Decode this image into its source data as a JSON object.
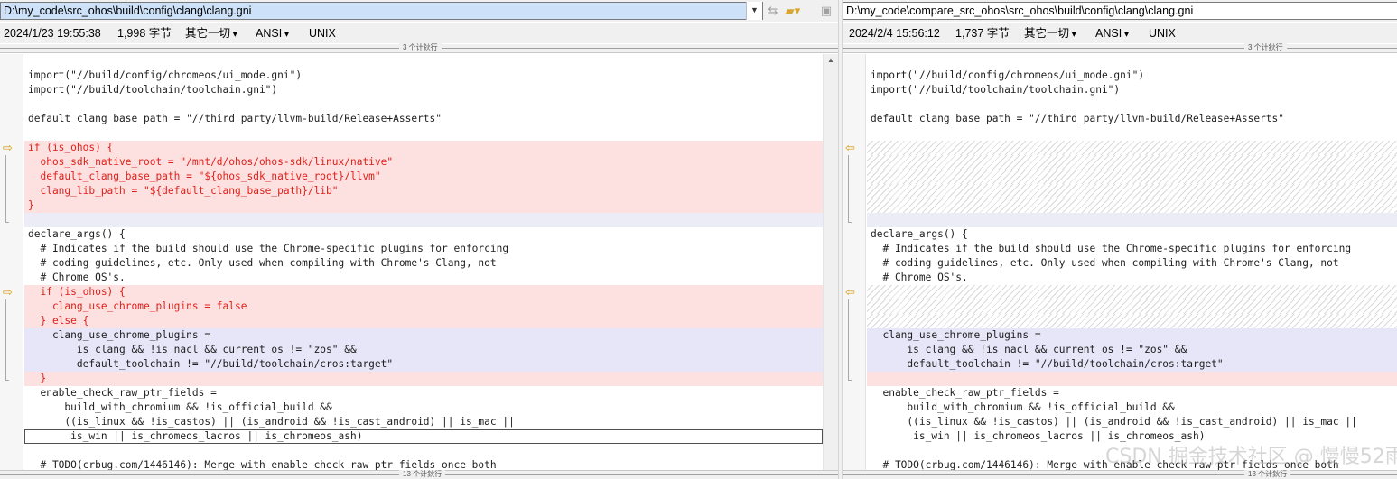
{
  "left": {
    "path": "D:\\my_code\\src_ohos\\build\\config\\clang\\clang.gni",
    "date": "2024/1/23 19:55:38",
    "size": "1,998 字节",
    "filter": "其它一切",
    "encoding": "ANSI",
    "line_endings": "UNIX",
    "top_section_label": "3 个计鈥行",
    "bottom_section_label": "13 个计鈥行",
    "lines": [
      "import(\"//build/config/chromeos/ui_mode.gni\")",
      "import(\"//build/toolchain/toolchain.gni\")",
      "",
      "default_clang_base_path = \"//third_party/llvm-build/Release+Asserts\"",
      "",
      "if (is_ohos) {",
      "  ohos_sdk_native_root = \"/mnt/d/ohos/ohos-sdk/linux/native\"",
      "  default_clang_base_path = \"${ohos_sdk_native_root}/llvm\"",
      "  clang_lib_path = \"${default_clang_base_path}/lib\"",
      "}",
      "",
      "declare_args() {",
      "  # Indicates if the build should use the Chrome-specific plugins for enforcing",
      "  # coding guidelines, etc. Only used when compiling with Chrome's Clang, not",
      "  # Chrome OS's.",
      "  if (is_ohos) {",
      "    clang_use_chrome_plugins = false",
      "  } else {",
      "    clang_use_chrome_plugins =",
      "        is_clang && !is_nacl && current_os != \"zos\" &&",
      "        default_toolchain != \"//build/toolchain/cros:target\"",
      "  }",
      "  enable_check_raw_ptr_fields =",
      "      build_with_chromium && !is_official_build &&",
      "      ((is_linux && !is_castos) || (is_android && !is_cast_android) || is_mac ||",
      "       is_win || is_chromeos_lacros || is_chromeos_ash)",
      "",
      "  # TODO(crbug.com/1446146): Merge with enable_check_raw_ptr_fields once both"
    ]
  },
  "right": {
    "path": "D:\\my_code\\compare_src_ohos\\src_ohos\\build\\config\\clang\\clang.gni",
    "date": "2024/2/4 15:56:12",
    "size": "1,737 字节",
    "filter": "其它一切",
    "encoding": "ANSI",
    "line_endings": "UNIX",
    "top_section_label": "3 个计鈥行",
    "bottom_section_label": "13 个计鈥行",
    "lines": [
      "import(\"//build/config/chromeos/ui_mode.gni\")",
      "import(\"//build/toolchain/toolchain.gni\")",
      "",
      "default_clang_base_path = \"//third_party/llvm-build/Release+Asserts\"",
      "",
      "",
      "",
      "",
      "",
      "",
      "",
      "declare_args() {",
      "  # Indicates if the build should use the Chrome-specific plugins for enforcing",
      "  # coding guidelines, etc. Only used when compiling with Chrome's Clang, not",
      "  # Chrome OS's.",
      "",
      "",
      "",
      "  clang_use_chrome_plugins =",
      "      is_clang && !is_nacl && current_os != \"zos\" &&",
      "      default_toolchain != \"//build/toolchain/cros:target\"",
      "",
      "  enable_check_raw_ptr_fields =",
      "      build_with_chromium && !is_official_build &&",
      "      ((is_linux && !is_castos) || (is_android && !is_cast_android) || is_mac ||",
      "       is_win || is_chromeos_lacros || is_chromeos_ash)",
      "",
      "  # TODO(crbug.com/1446146): Merge with enable_check_raw_ptr_fields once both"
    ]
  },
  "line_states": {
    "left": [
      "n",
      "n",
      "n",
      "n",
      "n",
      "del",
      "del",
      "del",
      "del",
      "del",
      "sep",
      "n",
      "n",
      "n",
      "n",
      "del",
      "del",
      "del",
      "chg",
      "chg",
      "chg",
      "del",
      "n",
      "n",
      "n",
      "cur",
      "n",
      "n"
    ],
    "right": [
      "n",
      "n",
      "n",
      "n",
      "n",
      "hatch",
      "hatch",
      "hatch",
      "hatch",
      "hatch",
      "sep",
      "n",
      "n",
      "n",
      "n",
      "hatch",
      "hatch",
      "hatch",
      "chg",
      "chg",
      "chg",
      "del",
      "n",
      "n",
      "n",
      "n",
      "n",
      "n"
    ]
  },
  "watermark": "CSDN 掘金技术社区 @ 慢慢52雨",
  "icons": {
    "combo": "chevron-down-icon",
    "nav": "swap-icon",
    "folder": "folder-icon",
    "save": "save-icon",
    "diff_marker_left": "arrow-right-icon",
    "diff_marker_right": "arrow-left-icon"
  }
}
